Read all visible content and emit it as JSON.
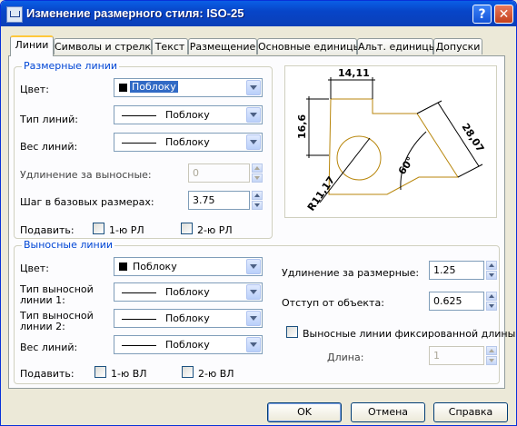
{
  "window": {
    "title": "Изменение размерного стиля: ISO-25",
    "help": "?",
    "close": "✕"
  },
  "tabs": [
    "Линии",
    "Символы и стрелки",
    "Текст",
    "Размещение",
    "Основные единицы",
    "Альт. единицы",
    "Допуски"
  ],
  "dim_lines": {
    "group_title": "Размерные линии",
    "color_label": "Цвет:",
    "color_value": "Поблоку",
    "linetype_label": "Тип линий:",
    "linetype_value": "Поблоку",
    "lineweight_label": "Вес линий:",
    "lineweight_value": "Поблоку",
    "extend_label": "Удлинение за выносные:",
    "extend_value": "0",
    "baseline_label": "Шаг в базовых размерах:",
    "baseline_value": "3.75",
    "suppress_label": "Подавить:",
    "suppress_1": "1-ю РЛ",
    "suppress_2": "2-ю РЛ"
  },
  "ext_lines": {
    "group_title": "Выносные линии",
    "color_label": "Цвет:",
    "color_value": "Поблоку",
    "linetype1_label_a": "Тип выносной",
    "linetype1_label_b": "линии 1:",
    "linetype1_value": "Поблоку",
    "linetype2_label_a": "Тип выносной",
    "linetype2_label_b": "линии 2:",
    "linetype2_value": "Поблоку",
    "lineweight_label": "Вес линий:",
    "lineweight_value": "Поблоку",
    "suppress_label": "Подавить:",
    "suppress_1": "1-ю ВЛ",
    "suppress_2": "2-ю ВЛ",
    "extend_label": "Удлинение за размерные:",
    "extend_value": "1.25",
    "offset_label": "Отступ от объекта:",
    "offset_value": "0.625",
    "fixed_label": "Выносные линии фиксированной длины",
    "length_label": "Длина:",
    "length_value": "1"
  },
  "preview": {
    "dim_top": "14,11",
    "dim_left": "16,6",
    "dim_right": "28,07",
    "dim_angle": "60°",
    "dim_radius": "R11,17"
  },
  "buttons": {
    "ok": "OK",
    "cancel": "Отмена",
    "help": "Справка"
  }
}
